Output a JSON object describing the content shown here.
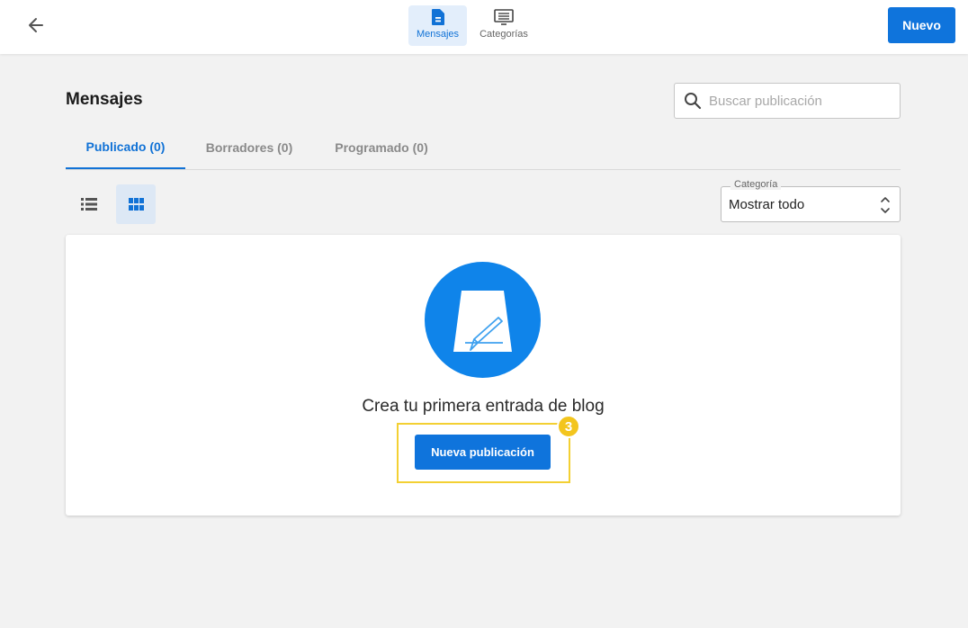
{
  "topbar": {
    "tabs": [
      {
        "label": "Mensajes",
        "icon": "document-icon",
        "active": true
      },
      {
        "label": "Categorías",
        "icon": "list-box-icon",
        "active": false
      }
    ],
    "new_button": "Nuevo"
  },
  "page": {
    "title": "Mensajes",
    "search_placeholder": "Buscar publicación"
  },
  "status_tabs": [
    {
      "label": "Publicado (0)",
      "active": true
    },
    {
      "label": "Borradores (0)",
      "active": false
    },
    {
      "label": "Programado (0)",
      "active": false
    }
  ],
  "view": {
    "mode": "grid"
  },
  "category": {
    "label": "Categoría",
    "value": "Mostrar todo"
  },
  "empty_state": {
    "message": "Crea tu primera entrada de blog",
    "button": "Nueva publicación",
    "step_badge": "3"
  },
  "colors": {
    "accent": "#0f74dc",
    "highlight": "#f3d033"
  }
}
